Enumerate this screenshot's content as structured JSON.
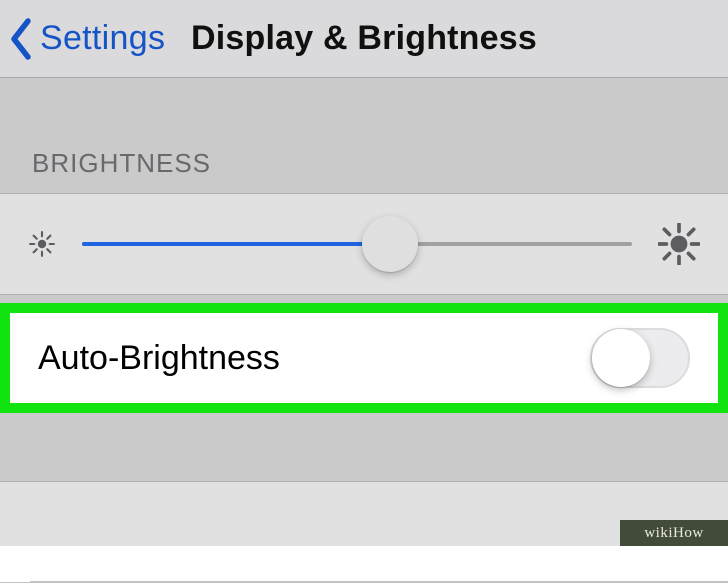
{
  "nav": {
    "back_label": "Settings",
    "title": "Display & Brightness"
  },
  "brightness": {
    "header": "BRIGHTNESS",
    "slider_percent": 56
  },
  "auto_brightness": {
    "label": "Auto-Brightness",
    "enabled": false
  },
  "watermark": "wikiHow"
}
